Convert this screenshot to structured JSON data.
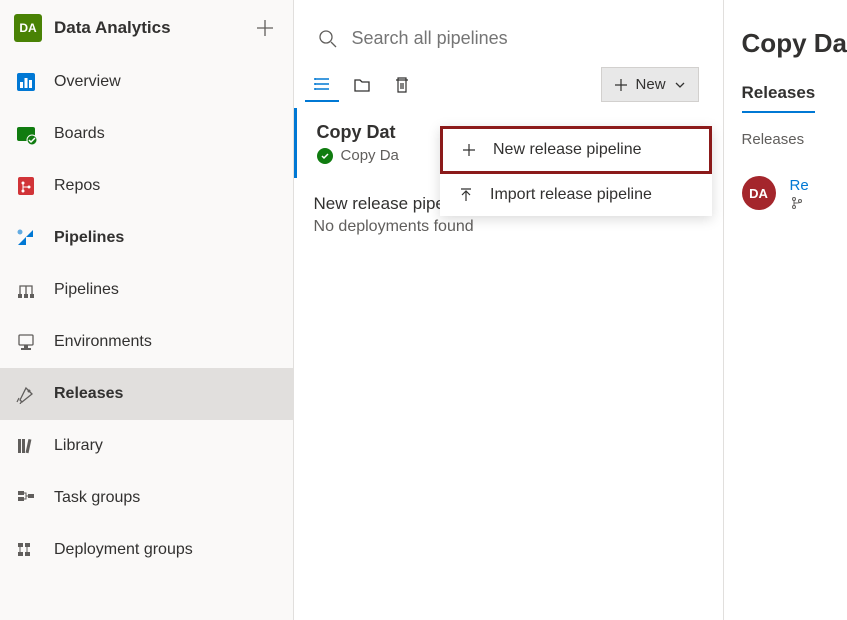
{
  "sidebar": {
    "avatar_initials": "DA",
    "project_title": "Data Analytics",
    "items": [
      {
        "label": "Overview"
      },
      {
        "label": "Boards"
      },
      {
        "label": "Repos"
      },
      {
        "label": "Pipelines"
      },
      {
        "label": "Pipelines"
      },
      {
        "label": "Environments"
      },
      {
        "label": "Releases"
      },
      {
        "label": "Library"
      },
      {
        "label": "Task groups"
      },
      {
        "label": "Deployment groups"
      }
    ]
  },
  "search": {
    "placeholder": "Search all pipelines"
  },
  "toolbar": {
    "new_label": "New"
  },
  "pipelines": [
    {
      "title": "Copy Dat",
      "status_text": "Copy Da"
    },
    {
      "title": "New release pipeline",
      "sub": "No deployments found"
    }
  ],
  "dropdown": {
    "items": [
      {
        "label": "New release pipeline"
      },
      {
        "label": "Import release pipeline"
      }
    ]
  },
  "right": {
    "title": "Copy Da",
    "tab_releases": "Releases",
    "subtab": "Releases",
    "release_avatar": "DA",
    "release_link": "Re",
    "release_branch": ""
  }
}
